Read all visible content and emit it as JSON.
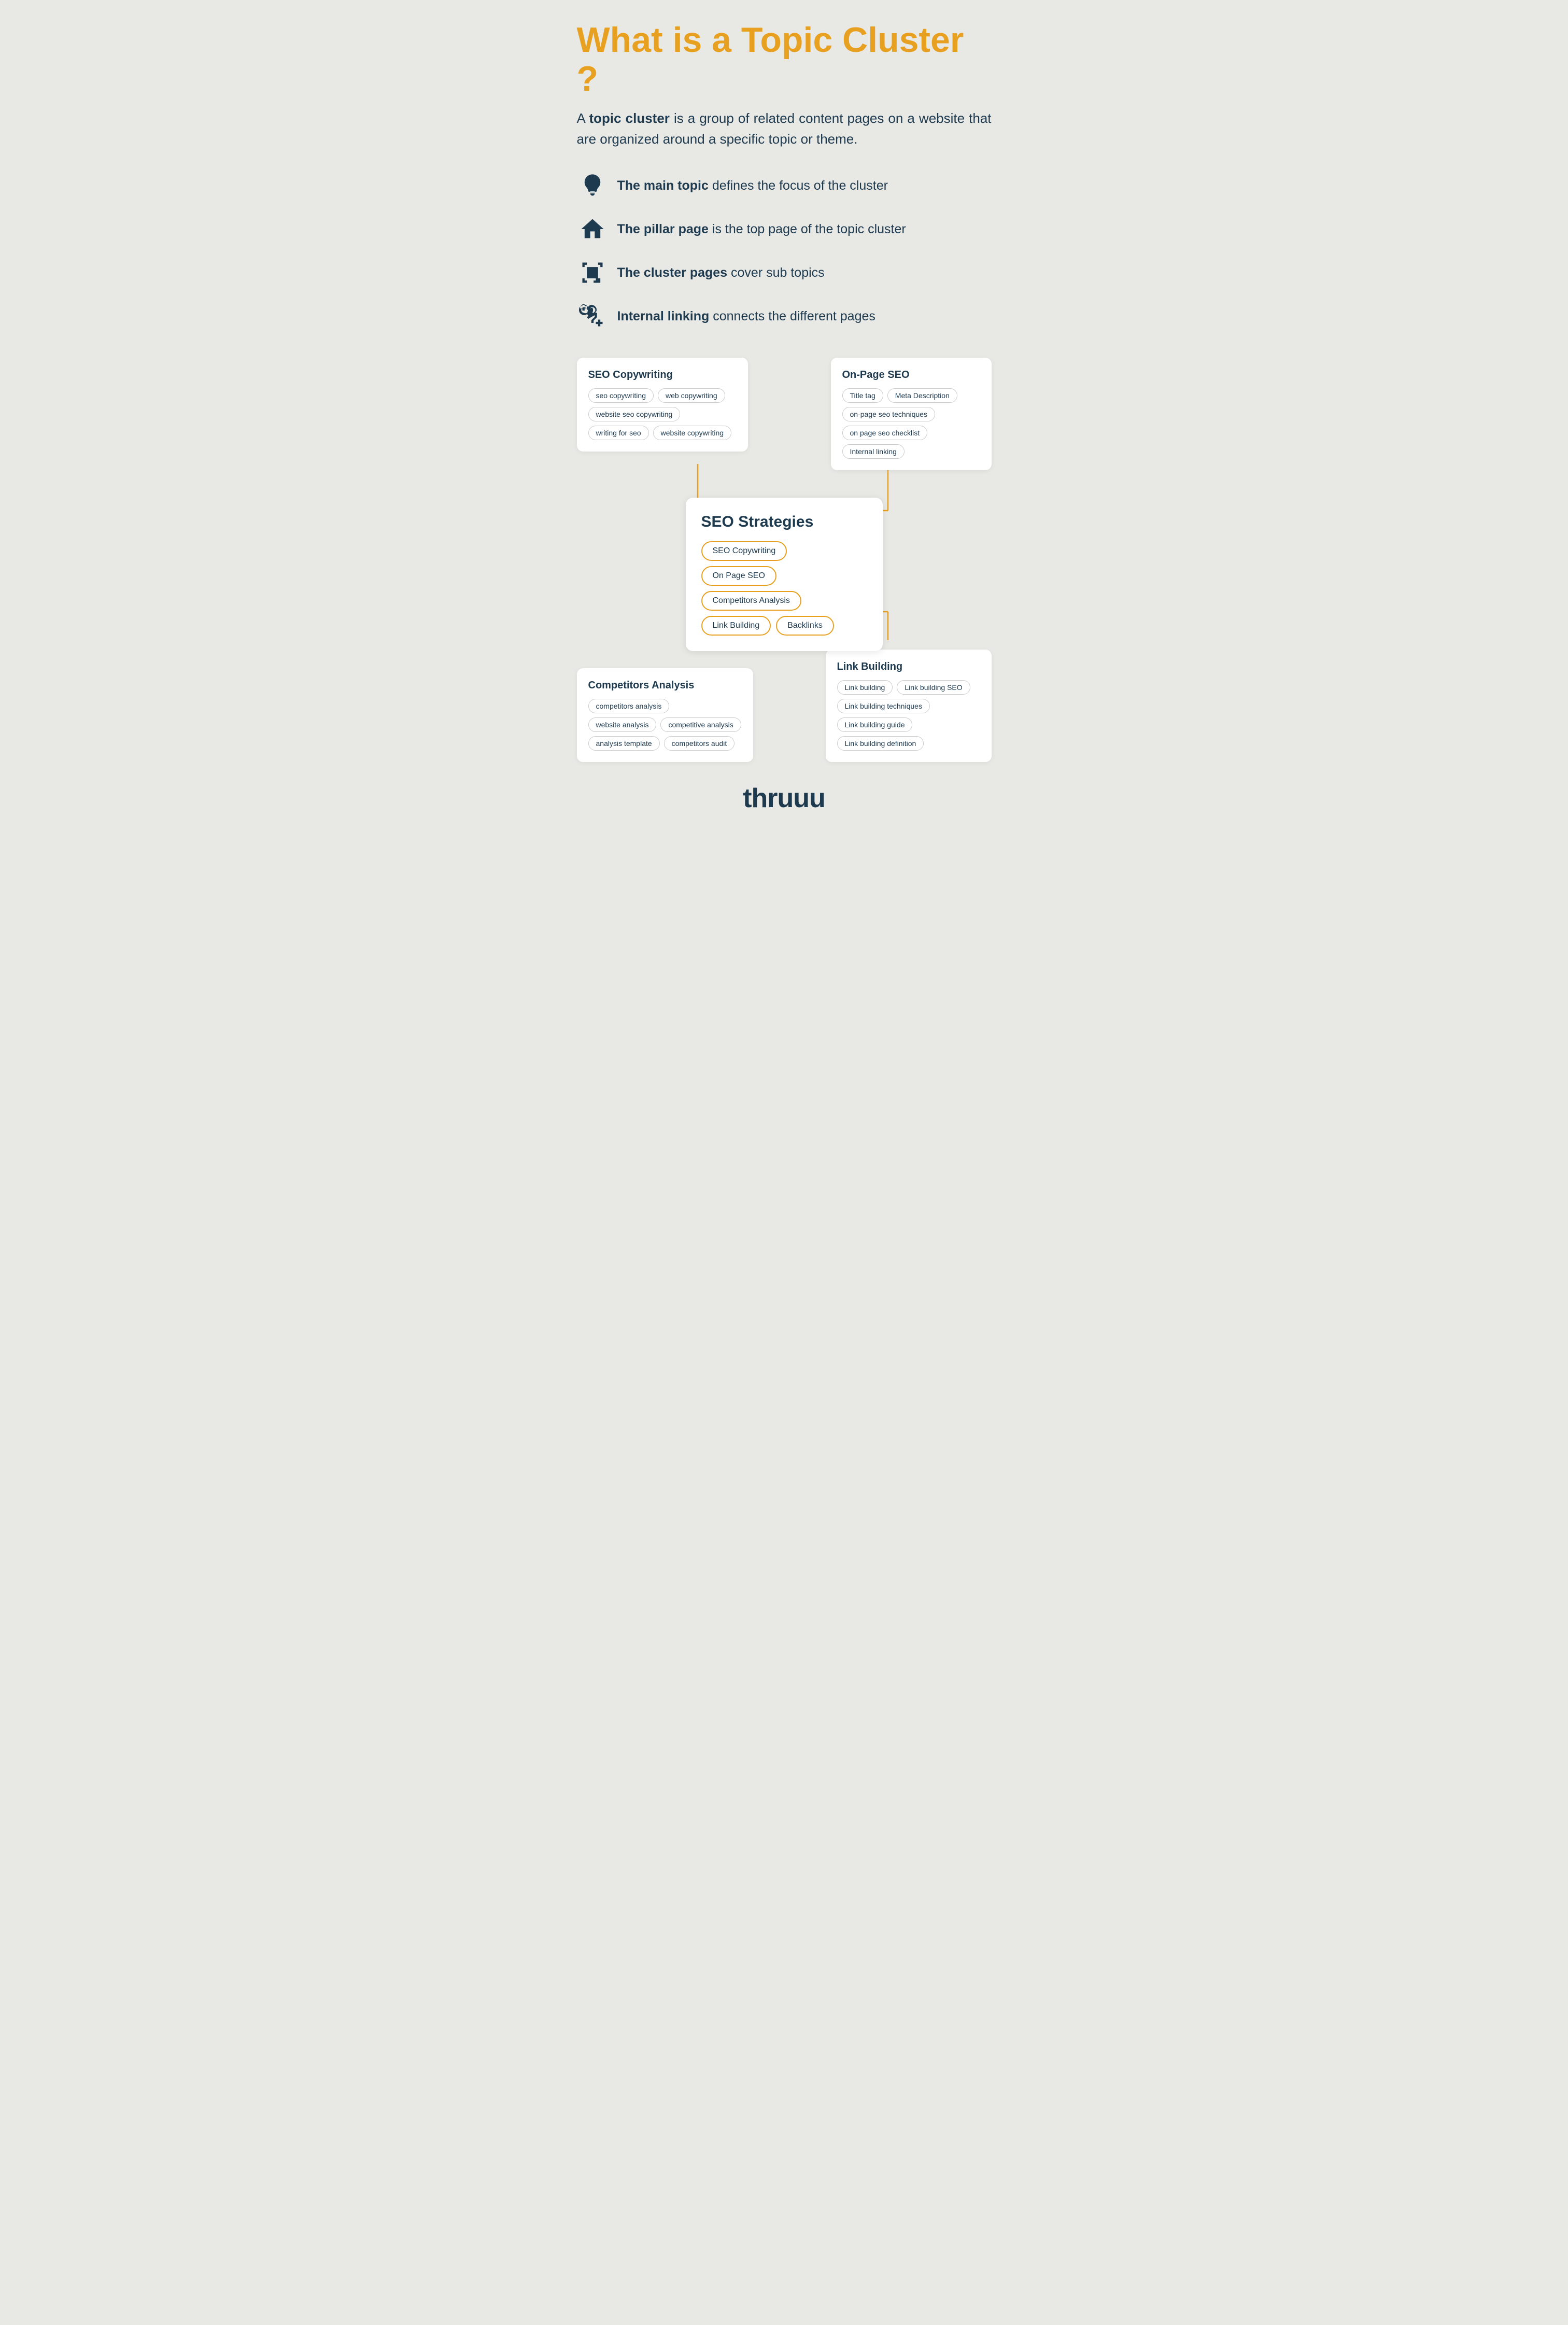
{
  "header": {
    "title": "What is a Topic Cluster ?",
    "intro": "A <strong>topic cluster</strong> is a group of related content pages on a website that are organized around a specific topic or theme."
  },
  "features": [
    {
      "id": "main-topic",
      "icon": "lightbulb",
      "bold": "The main topic",
      "rest": " defines the focus of the cluster"
    },
    {
      "id": "pillar-page",
      "icon": "house",
      "bold": "The pillar page",
      "rest": " is the top page of the topic cluster"
    },
    {
      "id": "cluster-pages",
      "icon": "focus",
      "bold": "The cluster pages",
      "rest": " cover sub topics"
    },
    {
      "id": "internal-linking",
      "icon": "link",
      "bold": "Internal linking",
      "rest": " connects the different pages"
    }
  ],
  "center_card": {
    "title": "SEO Strategies",
    "tags": [
      "SEO Copywriting",
      "On Page SEO",
      "Competitors Analysis",
      "Link Building",
      "Backlinks"
    ]
  },
  "top_left_card": {
    "title": "SEO Copywriting",
    "tags": [
      "seo copywriting",
      "web copywriting",
      "website seo copywriting",
      "writing for seo",
      "website copywriting"
    ]
  },
  "top_right_card": {
    "title": "On-Page SEO",
    "tags": [
      "Title tag",
      "Meta Description",
      "on-page seo techniques",
      "on page seo checklist",
      "Internal linking"
    ]
  },
  "bottom_left_card": {
    "title": "Competitors Analysis",
    "tags": [
      "competitors analysis",
      "website analysis",
      "competitive analysis",
      "analysis template",
      "competitors audit"
    ]
  },
  "bottom_right_card": {
    "title": "Link Building",
    "tags": [
      "Link building",
      "Link building SEO",
      "Link building techniques",
      "Link building guide",
      "Link building definition"
    ]
  },
  "brand": "thruuu"
}
